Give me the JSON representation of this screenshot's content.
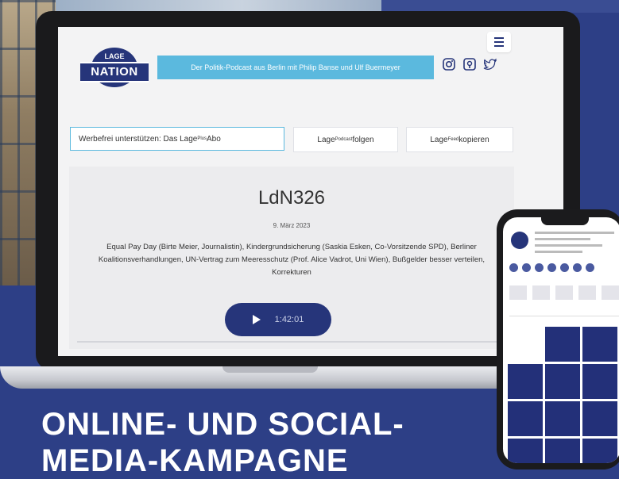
{
  "site": {
    "logo_top": "LAGE",
    "logo_main": "NATION",
    "tagline": "Der Politik-Podcast aus Berlin mit Philip Banse und Ulf Buermeyer"
  },
  "pills": {
    "support_prefix": "Werbefrei unterstützen: Das Lage",
    "support_sup": "Plus",
    "support_suffix": " Abo",
    "follow_prefix": "Lage ",
    "follow_sup": "Podcast",
    "follow_suffix": " folgen",
    "feed_prefix": "Lage ",
    "feed_sup": "Feed",
    "feed_suffix": " kopieren"
  },
  "episode": {
    "title": "LdN326",
    "date": "9. März 2023",
    "description": "Equal Pay Day (Birte Meier, Journalistin), Kindergrundsicherung (Saskia Esken, Co-Vorsitzende SPD), Berliner Koalitionsverhandlungen, UN-Vertrag zum Meeresschutz (Prof. Alice Vadrot, Uni Wien), Bußgelder besser verteilen, Korrekturen",
    "duration": "1:42:01"
  },
  "headline": {
    "line1": "ONLINE- UND SOCIAL-",
    "line2": "MEDIA-KAMPAGNE"
  },
  "icons": [
    "instagram-icon",
    "podcast-icon",
    "twitter-icon",
    "menu-icon",
    "play-icon"
  ],
  "colors": {
    "brand_navy": "#26357a",
    "accent_sky": "#5bb9de",
    "background": "#2d3f86"
  }
}
